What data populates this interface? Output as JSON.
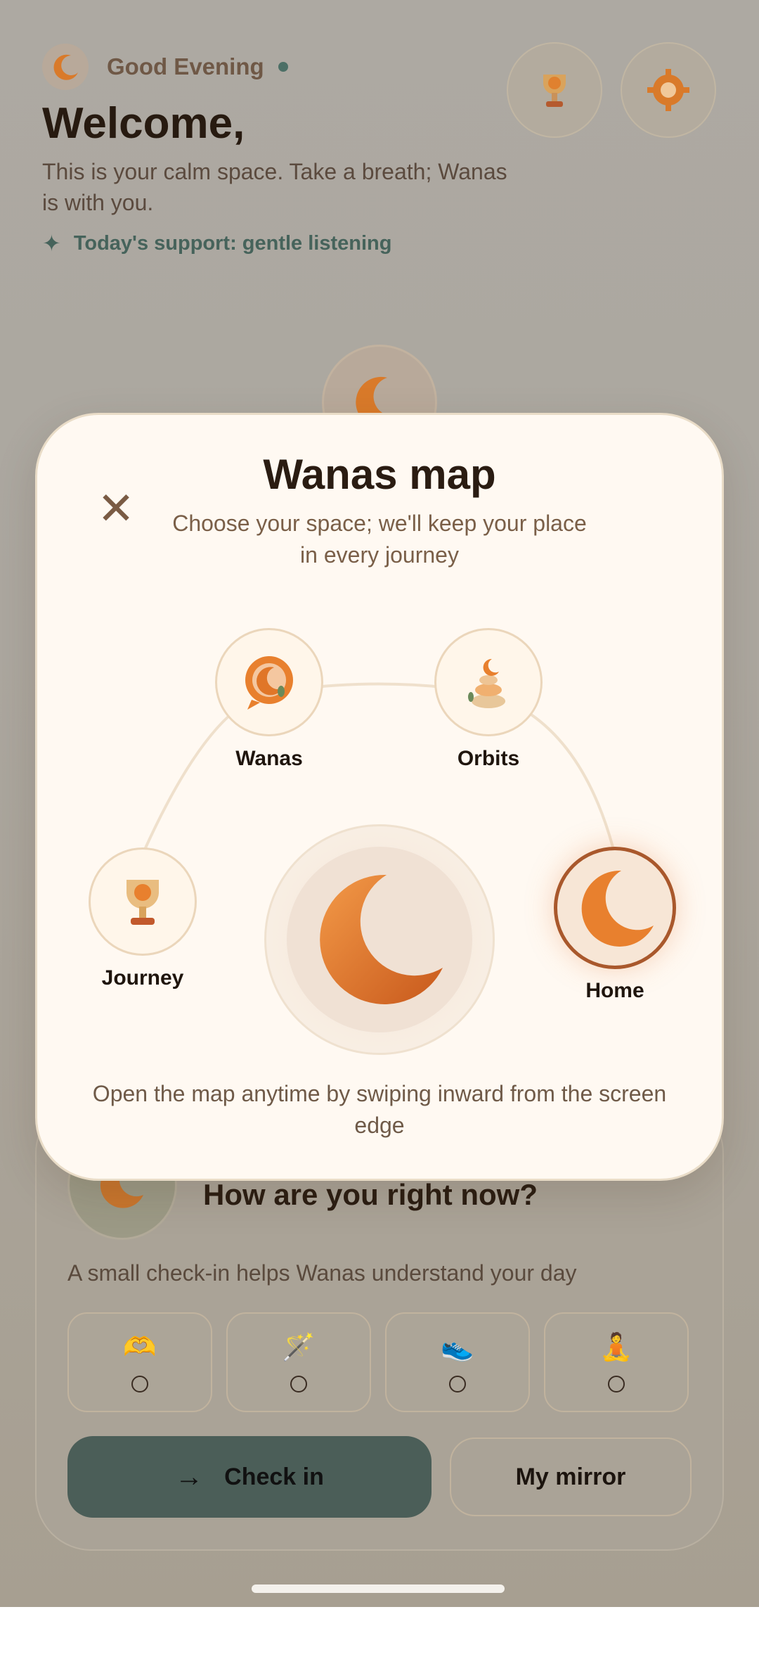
{
  "header": {
    "greeting": "Good Evening",
    "welcome": "Welcome,",
    "calm_message": "This is your calm space. Take a breath; Wanas is with you.",
    "support_text": "Today's support: gentle listening",
    "icons": [
      "moon-icon",
      "trophy-icon",
      "settings-gear-icon"
    ]
  },
  "checkin": {
    "title": "How are you right now?",
    "subtitle": "A small check-in helps Wanas understand your day",
    "moods": [
      {
        "glyph": "🫶"
      },
      {
        "glyph": "🪄"
      },
      {
        "glyph": "👟"
      },
      {
        "glyph": "🧘"
      }
    ],
    "primary_button": "Check in",
    "secondary_button": "My mirror"
  },
  "modal": {
    "title": "Wanas map",
    "subtitle": "Choose your space; we'll keep your place in every journey",
    "close_glyph": "✕",
    "nodes": {
      "wanas": "Wanas",
      "orbits": "Orbits",
      "journey": "Journey",
      "home": "Home"
    },
    "selected": "Home",
    "hint": "Open the map anytime by swiping inward from the screen edge"
  },
  "colors": {
    "accent_orange": "#e8802e",
    "accent_green": "#4b5e58",
    "modal_bg": "#fff9f2"
  }
}
